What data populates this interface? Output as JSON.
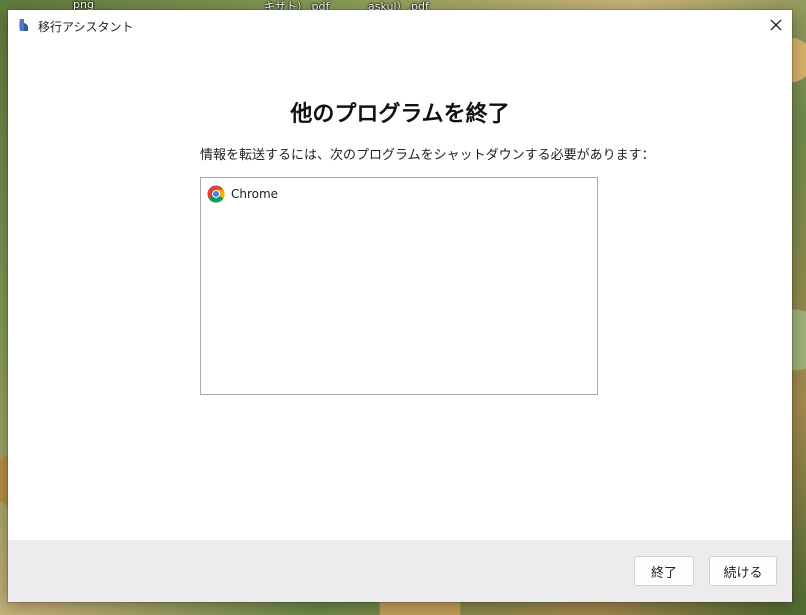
{
  "desktop": {
    "icon_labels": [
      "png",
      "キザト）.pdf",
      "askul）.pdf"
    ]
  },
  "window": {
    "title": "移行アシスタント",
    "heading": "他のプログラムを終了",
    "message": "情報を転送するには、次のプログラムをシャットダウンする必要があります：",
    "programs": [
      {
        "name": "Chrome",
        "icon": "chrome-icon"
      }
    ],
    "buttons": {
      "quit": "終了",
      "continue": "続ける"
    }
  },
  "colors": {
    "footer_bg": "#ecebee",
    "list_border": "#a8a8a8",
    "button_border": "#d3d3d3"
  }
}
